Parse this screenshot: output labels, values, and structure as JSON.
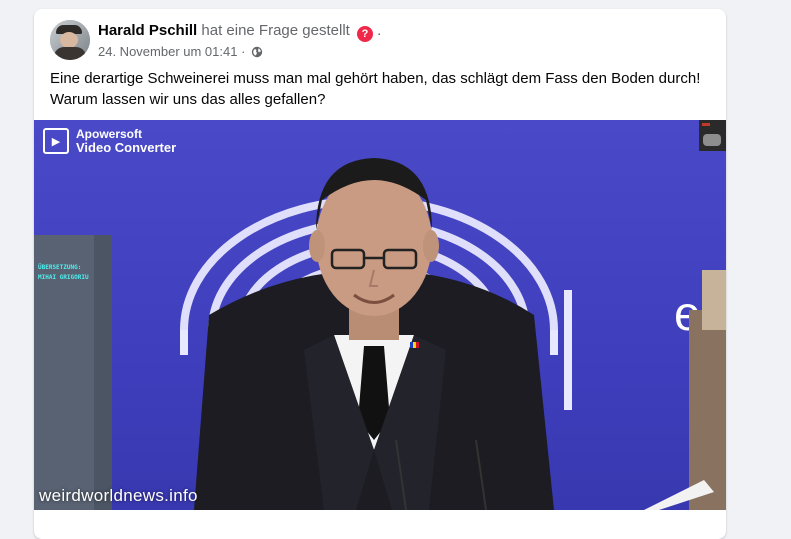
{
  "post": {
    "author": "Harald Pschill",
    "action_text": "hat eine Frage gestellt",
    "question_icon": "?",
    "trailing_dot": ".",
    "date": "24. November um 01:41",
    "separator": "·",
    "privacy_icon": "globe-icon",
    "text_line1": "Eine derartige Schweinerei muss man mal gehört haben, das schlägt dem Fass den Boden durch!",
    "text_line2": "Warum lassen wir uns das alles gefallen?"
  },
  "video": {
    "logo_line1": "Apowersoft",
    "logo_line2": "Video Converter",
    "credit_line1": "ÜBERSETZUNG:",
    "credit_line2": "MIHAI GRIGORIU",
    "watermark": "weirdworldnews.info",
    "background_color": "#3f3ec0"
  },
  "colors": {
    "accent_question": "#f02849",
    "meta_text": "#65676b"
  }
}
